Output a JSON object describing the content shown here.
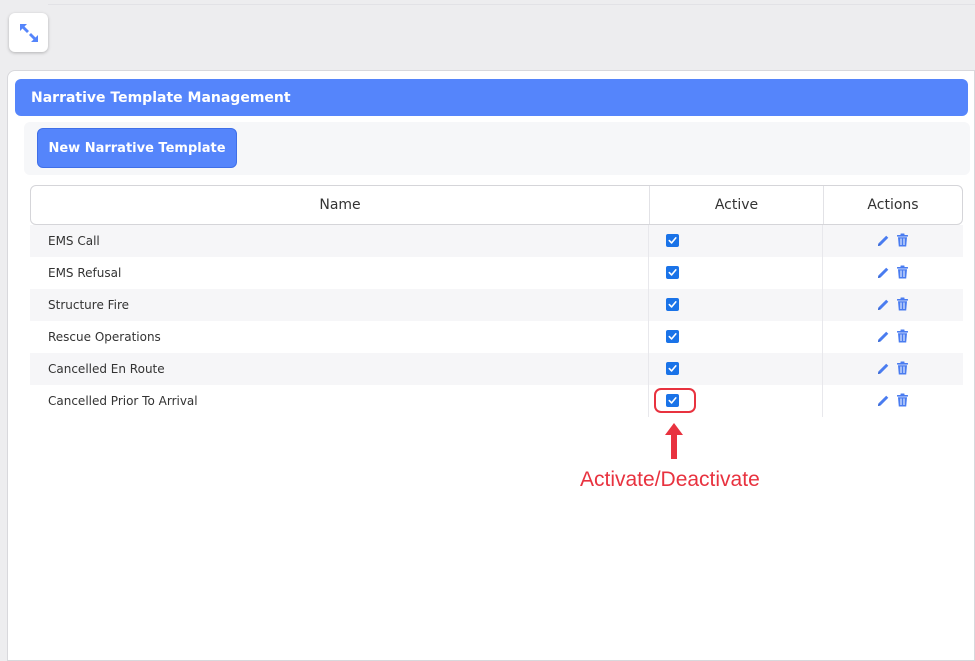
{
  "panel": {
    "title": "Narrative Template Management",
    "new_button_label": "New Narrative Template"
  },
  "grid": {
    "columns": [
      "Name",
      "Active",
      "Actions"
    ],
    "rows": [
      {
        "name": "EMS Call",
        "active": true
      },
      {
        "name": "EMS Refusal",
        "active": true
      },
      {
        "name": "Structure Fire",
        "active": true
      },
      {
        "name": "Rescue Operations",
        "active": true
      },
      {
        "name": "Cancelled En Route",
        "active": true
      },
      {
        "name": "Cancelled Prior To Arrival",
        "active": true
      }
    ]
  },
  "annotation": {
    "label": "Activate/Deactivate",
    "color": "#e8323f"
  },
  "icons": {
    "expand": "expand-icon",
    "edit": "pencil-icon",
    "delete": "trash-icon",
    "check": "checkmark-icon"
  },
  "colors": {
    "accent": "#5585fb",
    "checkbox": "#1a73e8",
    "annotation": "#e8323f"
  }
}
